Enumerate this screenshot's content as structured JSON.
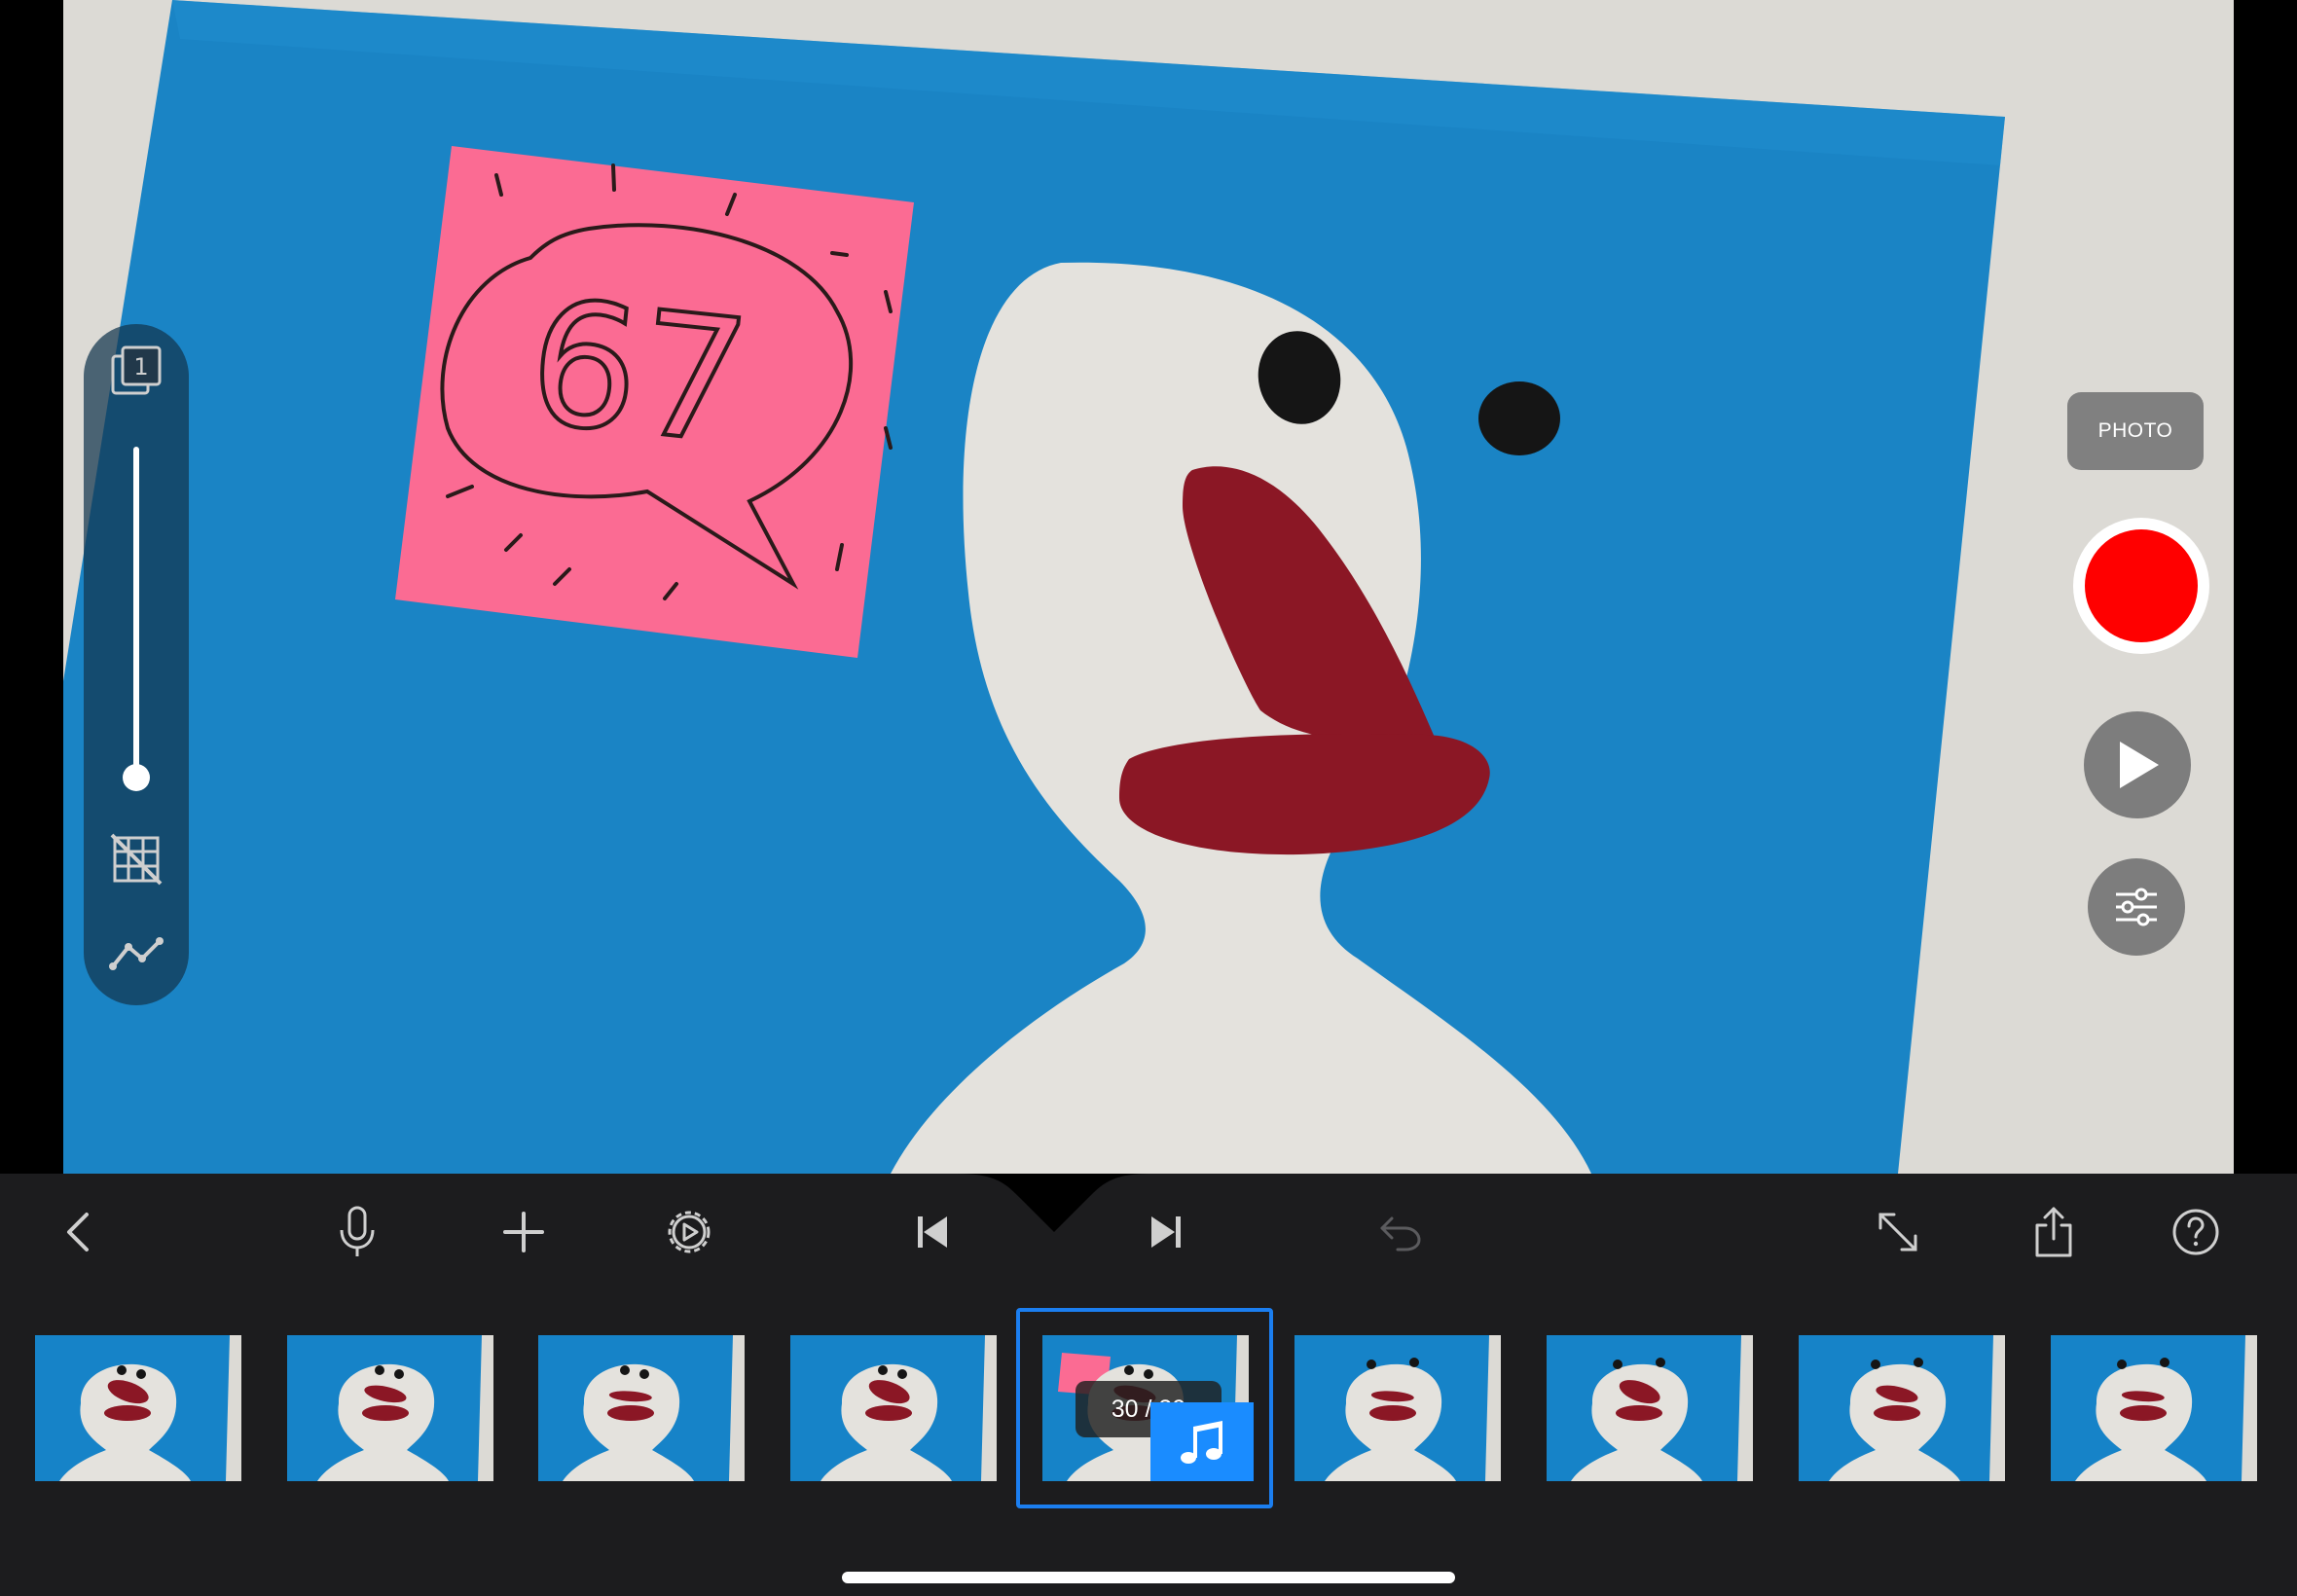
{
  "camera": {
    "photo_label": "PHOTO",
    "note_text": "67"
  },
  "left_tools": {
    "onion_skin_count": "1",
    "onion_skin_opacity": 0.0,
    "icons": [
      "onion-skin-icon",
      "grid-off-icon",
      "curve-icon"
    ]
  },
  "right_controls": {
    "icons": [
      "record-icon",
      "play-icon",
      "sliders-icon"
    ],
    "record_color": "#ff0000"
  },
  "toolbar": {
    "icons": [
      "back-chevron-icon",
      "microphone-icon",
      "plus-icon",
      "gear-icon",
      "skip-back-icon",
      "skip-forward-icon",
      "undo-icon",
      "expand-icon",
      "share-icon",
      "help-icon"
    ],
    "undo_enabled": false
  },
  "filmstrip": {
    "current_frame": 30,
    "total_frames": 39,
    "counter_text": "30 / 39",
    "selected_index": 4,
    "accent_color": "#1b7ef0",
    "frames_shown": 9,
    "audio_badge_icon": "music-notes-icon"
  }
}
